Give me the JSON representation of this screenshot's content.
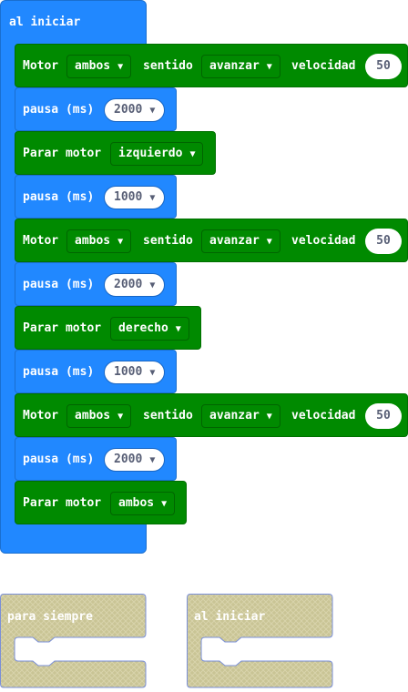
{
  "hat": {
    "label": "al iniciar"
  },
  "blocks": [
    {
      "type": "motor",
      "label": "Motor",
      "motor": "ambos",
      "dir_label": "sentido",
      "direction": "avanzar",
      "speed_label": "velocidad",
      "speed": "50"
    },
    {
      "type": "pause",
      "label": "pausa (ms)",
      "value": "2000"
    },
    {
      "type": "stop",
      "label": "Parar motor",
      "motor": "izquierdo"
    },
    {
      "type": "pause",
      "label": "pausa (ms)",
      "value": "1000"
    },
    {
      "type": "motor",
      "label": "Motor",
      "motor": "ambos",
      "dir_label": "sentido",
      "direction": "avanzar",
      "speed_label": "velocidad",
      "speed": "50"
    },
    {
      "type": "pause",
      "label": "pausa (ms)",
      "value": "2000"
    },
    {
      "type": "stop",
      "label": "Parar motor",
      "motor": "derecho"
    },
    {
      "type": "pause",
      "label": "pausa (ms)",
      "value": "1000"
    },
    {
      "type": "motor",
      "label": "Motor",
      "motor": "ambos",
      "dir_label": "sentido",
      "direction": "avanzar",
      "speed_label": "velocidad",
      "speed": "50"
    },
    {
      "type": "pause",
      "label": "pausa (ms)",
      "value": "2000"
    },
    {
      "type": "stop",
      "label": "Parar motor",
      "motor": "ambos"
    }
  ],
  "ghosts": [
    {
      "label": "para siempre"
    },
    {
      "label": "al iniciar"
    }
  ],
  "colors": {
    "event": "#2188ff",
    "motor": "#008a00",
    "ghost": "#c8c49a"
  },
  "icons": {
    "dropdown": "caret-down-icon"
  }
}
